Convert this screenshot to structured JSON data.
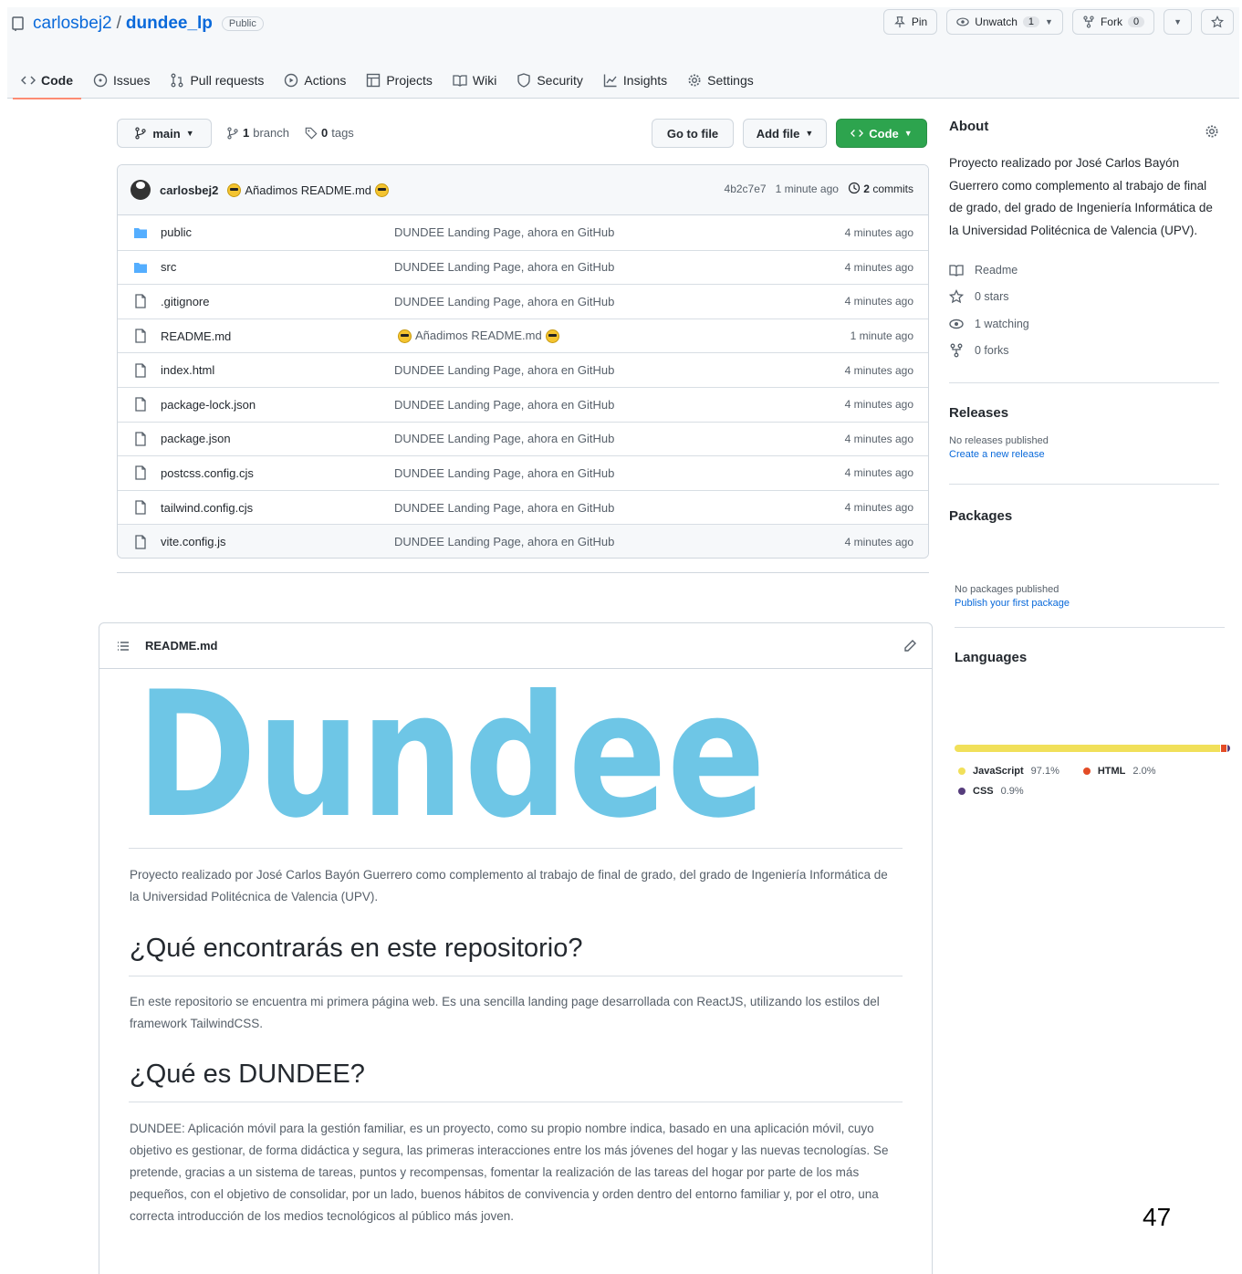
{
  "header": {
    "owner": "carlosbej2",
    "separator": "/",
    "repo": "dundee_lp",
    "visibility": "Public",
    "pin_label": "Pin",
    "unwatch_label": "Unwatch",
    "unwatch_count": "1",
    "fork_label": "Fork",
    "fork_count": "0"
  },
  "tabs": [
    {
      "label": "Code",
      "icon": "code-icon"
    },
    {
      "label": "Issues",
      "icon": "issue-icon"
    },
    {
      "label": "Pull requests",
      "icon": "pull-request-icon"
    },
    {
      "label": "Actions",
      "icon": "play-icon"
    },
    {
      "label": "Projects",
      "icon": "table-icon"
    },
    {
      "label": "Wiki",
      "icon": "book-icon"
    },
    {
      "label": "Security",
      "icon": "shield-icon"
    },
    {
      "label": "Insights",
      "icon": "graph-icon"
    },
    {
      "label": "Settings",
      "icon": "gear-icon"
    }
  ],
  "toolbar": {
    "branch": "main",
    "branch_count": "1",
    "branch_word": "branch",
    "tag_count": "0",
    "tag_word": "tags",
    "go_to_file": "Go to file",
    "add_file": "Add file",
    "code": "Code"
  },
  "commit": {
    "user": "carlosbej2",
    "message": "Añadimos README.md",
    "hash": "4b2c7e7",
    "time": "1 minute ago",
    "count": "2",
    "count_word": "commits"
  },
  "files": [
    {
      "type": "dir",
      "name": "public",
      "message": "DUNDEE Landing Page, ahora en GitHub",
      "time": "4 minutes ago"
    },
    {
      "type": "dir",
      "name": "src",
      "message": "DUNDEE Landing Page, ahora en GitHub",
      "time": "4 minutes ago"
    },
    {
      "type": "file",
      "name": ".gitignore",
      "message": "DUNDEE Landing Page, ahora en GitHub",
      "time": "4 minutes ago"
    },
    {
      "type": "file",
      "name": "README.md",
      "message": "Añadimos README.md",
      "time": "1 minute ago"
    },
    {
      "type": "file",
      "name": "index.html",
      "message": "DUNDEE Landing Page, ahora en GitHub",
      "time": "4 minutes ago"
    },
    {
      "type": "file",
      "name": "package-lock.json",
      "message": "DUNDEE Landing Page, ahora en GitHub",
      "time": "4 minutes ago"
    },
    {
      "type": "file",
      "name": "package.json",
      "message": "DUNDEE Landing Page, ahora en GitHub",
      "time": "4 minutes ago"
    },
    {
      "type": "file",
      "name": "postcss.config.cjs",
      "message": "DUNDEE Landing Page, ahora en GitHub",
      "time": "4 minutes ago"
    },
    {
      "type": "file",
      "name": "tailwind.config.cjs",
      "message": "DUNDEE Landing Page, ahora en GitHub",
      "time": "4 minutes ago"
    },
    {
      "type": "file",
      "name": "vite.config.js",
      "message": "DUNDEE Landing Page, ahora en GitHub",
      "time": "4 minutes ago"
    }
  ],
  "readme": {
    "filename": "README.md",
    "logo_text": "Dundee",
    "intro": "Proyecto realizado por José Carlos Bayón Guerrero como complemento al trabajo de final de grado, del grado de Ingeniería Informática de la Universidad Politécnica de Valencia (UPV).",
    "h2_1": "¿Qué encontrarás en este repositorio?",
    "p_1": "En este repositorio se encuentra mi primera página web. Es una sencilla landing page desarrollada con ReactJS, utilizando los estilos del framework TailwindCSS.",
    "h2_2": "¿Qué es DUNDEE?",
    "p_2": "DUNDEE: Aplicación móvil para la gestión familiar, es un proyecto, como su propio nombre indica, basado en una aplicación móvil, cuyo objetivo es gestionar, de forma didáctica y segura, las primeras interacciones entre los más jóvenes del hogar y las nuevas tecnologías. Se pretende, gracias a un sistema de tareas, puntos y recompensas, fomentar la realización de las tareas del hogar por parte de los más pequeños, con el objetivo de consolidar, por un lado, buenos hábitos de convivencia y orden dentro del entorno familiar y, por el otro, una correcta introducción de los medios tecnológicos al público más joven."
  },
  "about": {
    "title": "About",
    "description": "Proyecto realizado por José Carlos Bayón Guerrero como complemento al trabajo de final de grado, del grado de Ingeniería Informática de la Universidad Politécnica de Valencia (UPV).",
    "readme": "Readme",
    "stars": "0 stars",
    "watching": "1 watching",
    "forks": "0 forks"
  },
  "releases": {
    "title": "Releases",
    "none": "No releases published",
    "create": "Create a new release"
  },
  "packages": {
    "title": "Packages",
    "none": "No packages published",
    "publish": "Publish your first package"
  },
  "languages": {
    "title": "Languages",
    "items": [
      {
        "name": "JavaScript",
        "percent": "97.1%",
        "value": 97.1,
        "color": "#f1e05a"
      },
      {
        "name": "HTML",
        "percent": "2.0%",
        "value": 2.0,
        "color": "#e34c26"
      },
      {
        "name": "CSS",
        "percent": "0.9%",
        "value": 0.9,
        "color": "#563d7c"
      }
    ]
  },
  "page_number": "47"
}
